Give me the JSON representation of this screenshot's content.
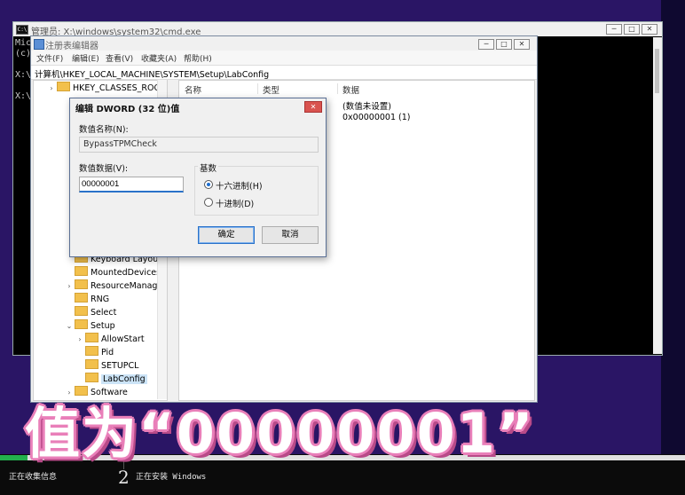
{
  "cmd": {
    "title": "管理员: X:\\windows\\system32\\cmd.exe",
    "lines": [
      "Mic",
      "(c)",
      "X:\\",
      "X:\\"
    ],
    "controls": {
      "minimize": "─",
      "maximize": "□",
      "close": "✕"
    }
  },
  "regedit": {
    "title": "注册表编辑器",
    "menu": [
      "文件(F)",
      "编辑(E)",
      "查看(V)",
      "收藏夹(A)",
      "帮助(H)"
    ],
    "address": "计算机\\HKEY_LOCAL_MACHINE\\SYSTEM\\Setup\\LabConfig",
    "controls": {
      "minimize": "─",
      "maximize": "□",
      "close": "✕"
    },
    "tree": [
      {
        "label": "HKEY_CLASSES_ROOT",
        "chevron": "›"
      },
      {
        "label": "Keyboard Layout",
        "chevron": ""
      },
      {
        "label": "MountedDevices",
        "chevron": ""
      },
      {
        "label": "ResourceManager",
        "chevron": "›"
      },
      {
        "label": "RNG",
        "chevron": ""
      },
      {
        "label": "Select",
        "chevron": ""
      },
      {
        "label": "Setup",
        "chevron": "⌄"
      },
      {
        "label": "AllowStart",
        "chevron": "›"
      },
      {
        "label": "Pid",
        "chevron": ""
      },
      {
        "label": "SETUPCL",
        "chevron": ""
      },
      {
        "label": "LabConfig",
        "chevron": ""
      },
      {
        "label": "Software",
        "chevron": "›"
      }
    ],
    "columns": [
      "名称",
      "类型",
      "数据"
    ],
    "values": [
      {
        "data": "(数值未设置)"
      },
      {
        "data": "0x00000001 (1)"
      }
    ]
  },
  "dialog": {
    "title": "编辑 DWORD (32 位)值",
    "name_label": "数值名称(N):",
    "name_value": "BypassTPMCheck",
    "data_label": "数值数据(V):",
    "data_value": "00000001",
    "base_label": "基数",
    "hex_label": "十六进制(H)",
    "dec_label": "十进制(D)",
    "selected_base": "hex",
    "ok": "确定",
    "cancel": "取消",
    "close": "✕"
  },
  "setup": {
    "step1": "正在收集信息",
    "step2_num": "2",
    "step2": "正在安装 Windows",
    "progress_fraction": 0.04
  },
  "caption": "值为“00000001”",
  "colors": {
    "background": "#2a1565",
    "caption_outline": "#e97fb9",
    "accent": "#2a72c9",
    "progress": "#23b14d"
  }
}
